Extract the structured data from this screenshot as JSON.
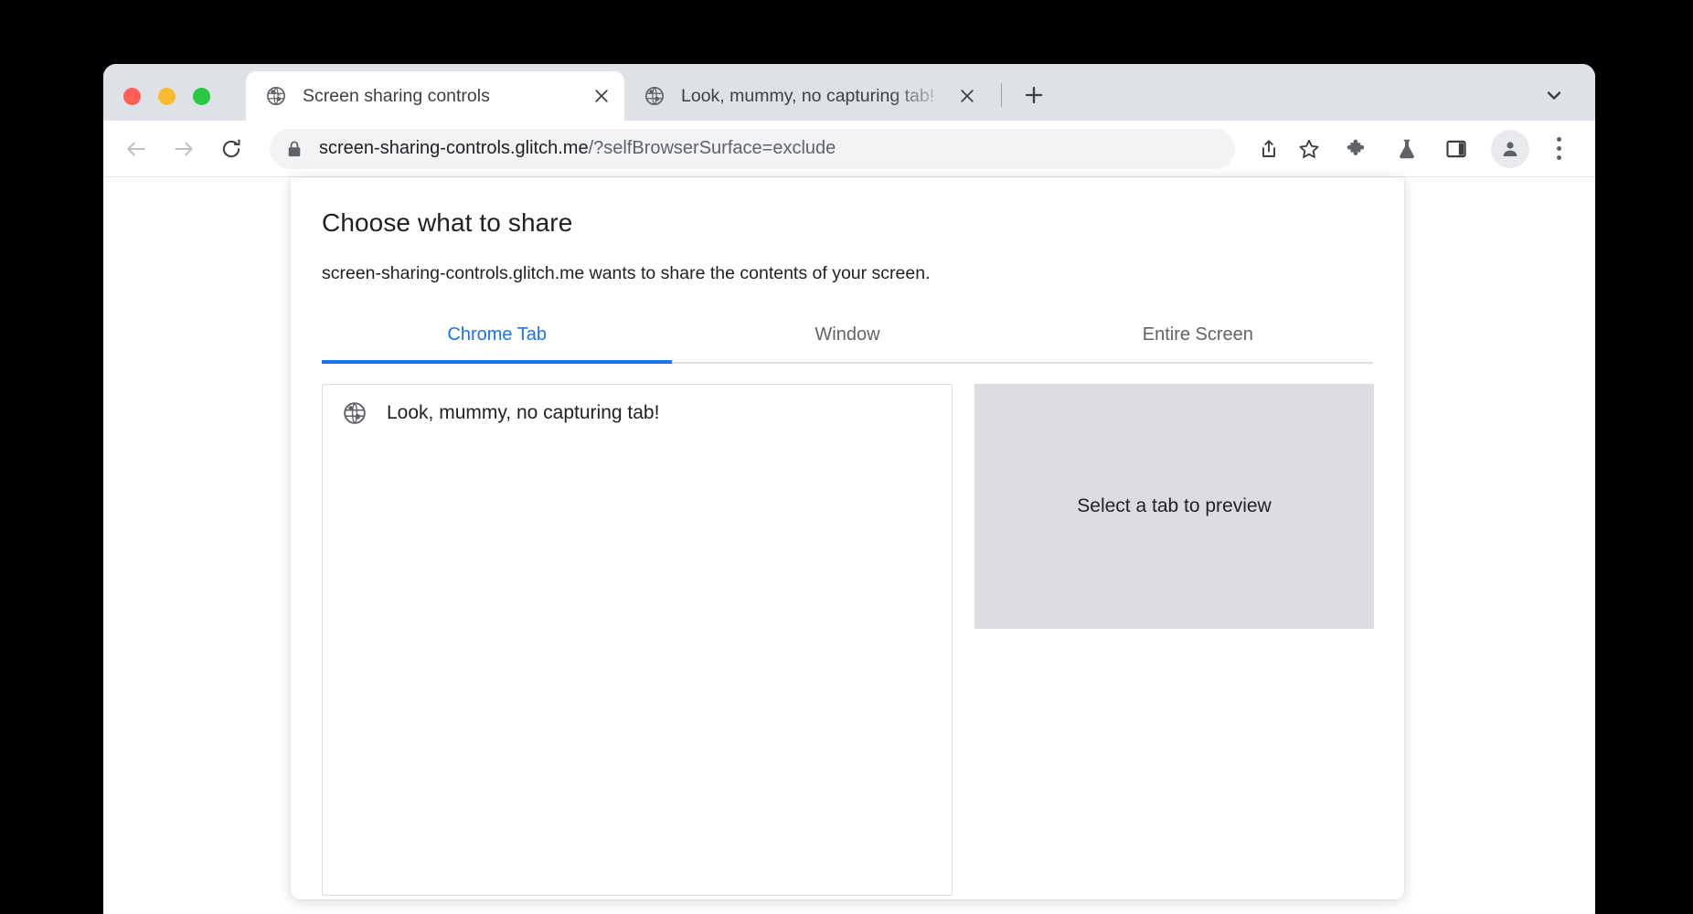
{
  "window": {
    "traffic_lights": [
      {
        "name": "close",
        "color": "#ff5f57"
      },
      {
        "name": "minimize",
        "color": "#f7bd2e"
      },
      {
        "name": "zoom",
        "color": "#28c840"
      }
    ],
    "tabs": [
      {
        "title": "Screen sharing controls",
        "active": true,
        "favicon": "globe-icon"
      },
      {
        "title": "Look, mummy, no capturing tab!",
        "active": false,
        "favicon": "globe-icon"
      }
    ],
    "new_tab_label": "+",
    "tab_search_label": "⌄"
  },
  "toolbar": {
    "back_label": "←",
    "forward_label": "→",
    "reload_label": "↻",
    "url_secure": "screen-sharing-controls.glitch.me",
    "url_path": "/?selfBrowserSurface=exclude",
    "url_full": "screen-sharing-controls.glitch.me/?selfBrowserSurface=exclude",
    "icons": [
      "share-icon",
      "bookmark-star-icon",
      "extensions-puzzle-icon",
      "labs-flask-icon",
      "side-panel-icon",
      "profile-avatar-icon",
      "three-dot-menu-icon"
    ]
  },
  "dialog": {
    "title": "Choose what to share",
    "subtitle": "screen-sharing-controls.glitch.me wants to share the contents of your screen.",
    "tabs": [
      {
        "label": "Chrome Tab",
        "active": true
      },
      {
        "label": "Window",
        "active": false
      },
      {
        "label": "Entire Screen",
        "active": false
      }
    ],
    "sources": [
      {
        "label": "Look, mummy, no capturing tab!",
        "favicon": "globe-icon"
      }
    ],
    "preview": {
      "placeholder": "Select a tab to preview",
      "background": "#dadce0"
    },
    "accent_color": "#1a73e8"
  }
}
